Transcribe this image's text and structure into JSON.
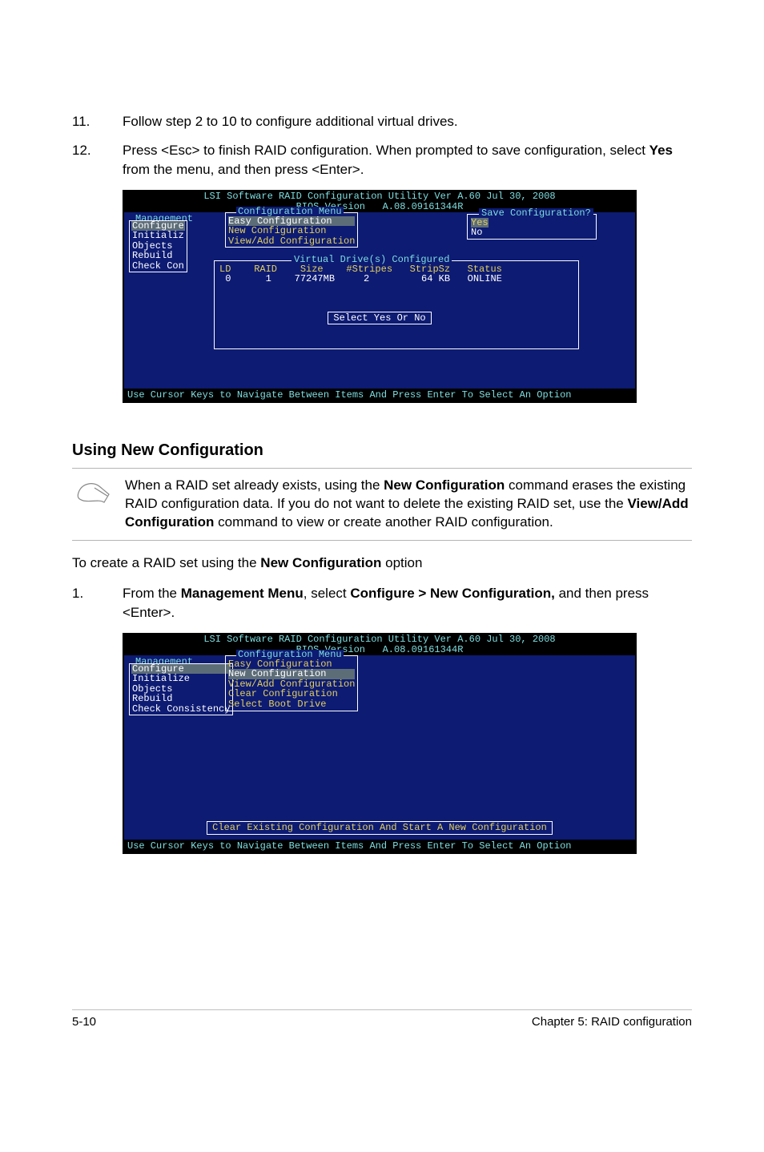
{
  "steps": [
    {
      "num": "11.",
      "text": "Follow step 2 to 10 to configure additional virtual drives."
    },
    {
      "num": "12.",
      "text_a": "Press <Esc> to finish RAID configuration. When prompted to save configuration, select ",
      "bold_1": "Yes",
      "text_b": " from the menu, and then press <Enter>."
    }
  ],
  "bios1": {
    "title_l1": "LSI Software RAID Configuration Utility Ver A.60 Jul 30, 2008",
    "title_l2": "BIOS Version   A.08.09161344R",
    "side_label": "Management",
    "side_items": [
      "Configure",
      "Initializ",
      "Objects",
      "Rebuild",
      "Check Con"
    ],
    "config_title": "Configuration Menu",
    "config_items": [
      "Easy Configuration",
      "New Configuration",
      "View/Add Configuration"
    ],
    "save_title": "Save Configuration?",
    "save_yes": "Yes",
    "save_no": "No",
    "vd_title": "Virtual Drive(s) Configured",
    "vd_head": "LD    RAID    Size    #Stripes   StripSz   Status",
    "vd_row": " 0      1    77247MB     2         64 KB   ONLINE",
    "select_text": "Select Yes Or No",
    "footer": "Use Cursor Keys to Navigate Between Items And Press Enter To Select An Option"
  },
  "section_heading": "Using New Configuration",
  "note": {
    "text_a": "When a RAID set already exists, using the ",
    "bold_1": "New Configuration",
    "text_b": " command erases the existing RAID configuration data. If you do not want to delete the existing RAID set, use the ",
    "bold_2": "View/Add Configuration",
    "text_c": " command to view or create another RAID configuration."
  },
  "plain_line": {
    "text_a": "To create a RAID set using the ",
    "bold": "New Configuration",
    "text_b": " option"
  },
  "step1": {
    "num": "1.",
    "text_a": "From the ",
    "bold_1": "Management Menu",
    "text_b": ", select ",
    "bold_2": "Configure > New Configuration,",
    "text_c": " and then press <Enter>."
  },
  "bios2": {
    "title_l1": "LSI Software RAID Configuration Utility Ver A.60 Jul 30, 2008",
    "title_l2": "BIOS Version   A.08.09161344R",
    "side_label": "Management",
    "side_items": [
      "Configure",
      "Initialize",
      "Objects",
      "Rebuild",
      "Check Consistency"
    ],
    "config_title": "Configuration Menu",
    "config_items": [
      "Easy Configuration",
      "New Configuration",
      "View/Add Configuration",
      "Clear Configuration",
      "Select Boot Drive"
    ],
    "hint": "Clear Existing Configuration And Start A New Configuration",
    "footer": "Use Cursor Keys to Navigate Between Items And Press Enter To Select An Option"
  },
  "page_footer": {
    "left": "5-10",
    "right": "Chapter 5: RAID configuration"
  }
}
